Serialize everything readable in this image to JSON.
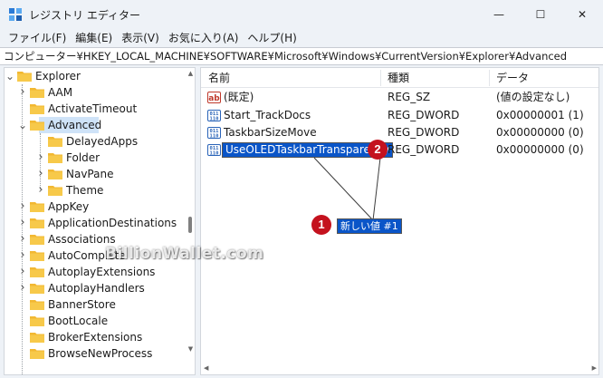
{
  "window": {
    "title": "レジストリ エディター",
    "controls": {
      "minimize": "—",
      "maximize": "☐",
      "close": "✕"
    }
  },
  "menubar": [
    "ファイル(F)",
    "編集(E)",
    "表示(V)",
    "お気に入り(A)",
    "ヘルプ(H)"
  ],
  "address": "コンピューター¥HKEY_LOCAL_MACHINE¥SOFTWARE¥Microsoft¥Windows¥CurrentVersion¥Explorer¥Advanced",
  "tree": {
    "items": [
      {
        "label": "Explorer",
        "expanded": true
      },
      {
        "label": "AAM",
        "expanded": false
      },
      {
        "label": "ActivateTimeout",
        "expanded": false
      },
      {
        "label": "Advanced",
        "expanded": true,
        "selected": true
      },
      {
        "label": "DelayedApps",
        "expanded": false
      },
      {
        "label": "Folder",
        "expanded": false
      },
      {
        "label": "NavPane",
        "expanded": false
      },
      {
        "label": "Theme",
        "expanded": false
      },
      {
        "label": "AppKey",
        "expanded": false
      },
      {
        "label": "ApplicationDestinations",
        "expanded": false
      },
      {
        "label": "Associations",
        "expanded": false
      },
      {
        "label": "AutoComplete",
        "expanded": false
      },
      {
        "label": "AutoplayExtensions",
        "expanded": false
      },
      {
        "label": "AutoplayHandlers",
        "expanded": false
      },
      {
        "label": "BannerStore",
        "expanded": false
      },
      {
        "label": "BootLocale",
        "expanded": false
      },
      {
        "label": "BrokerExtensions",
        "expanded": false
      },
      {
        "label": "BrowseNewProcess",
        "expanded": false
      }
    ]
  },
  "list": {
    "columns": {
      "name": "名前",
      "type": "種類",
      "data": "データ"
    },
    "rows": [
      {
        "icon": "string-value-icon",
        "name": "(既定)",
        "type": "REG_SZ",
        "data": "(値の設定なし)"
      },
      {
        "icon": "binary-value-icon",
        "name": "Start_TrackDocs",
        "type": "REG_DWORD",
        "data": "0x00000001 (1)"
      },
      {
        "icon": "binary-value-icon",
        "name": "TaskbarSizeMove",
        "type": "REG_DWORD",
        "data": "0x00000000 (0)"
      },
      {
        "icon": "binary-value-icon",
        "name": "UseOLEDTaskbarTransparency",
        "type": "REG_DWORD",
        "data": "0x00000000 (0)",
        "editing": true
      }
    ]
  },
  "annotations": {
    "badge1": "1",
    "badge2": "2",
    "new_value_label": "新しい値 #1",
    "watermark": "BillionWallet.com"
  },
  "colors": {
    "selection": "#0a55c8",
    "badge": "#c4121e",
    "folder": "#f2b832",
    "tree_selected": "#cfe3f8"
  }
}
